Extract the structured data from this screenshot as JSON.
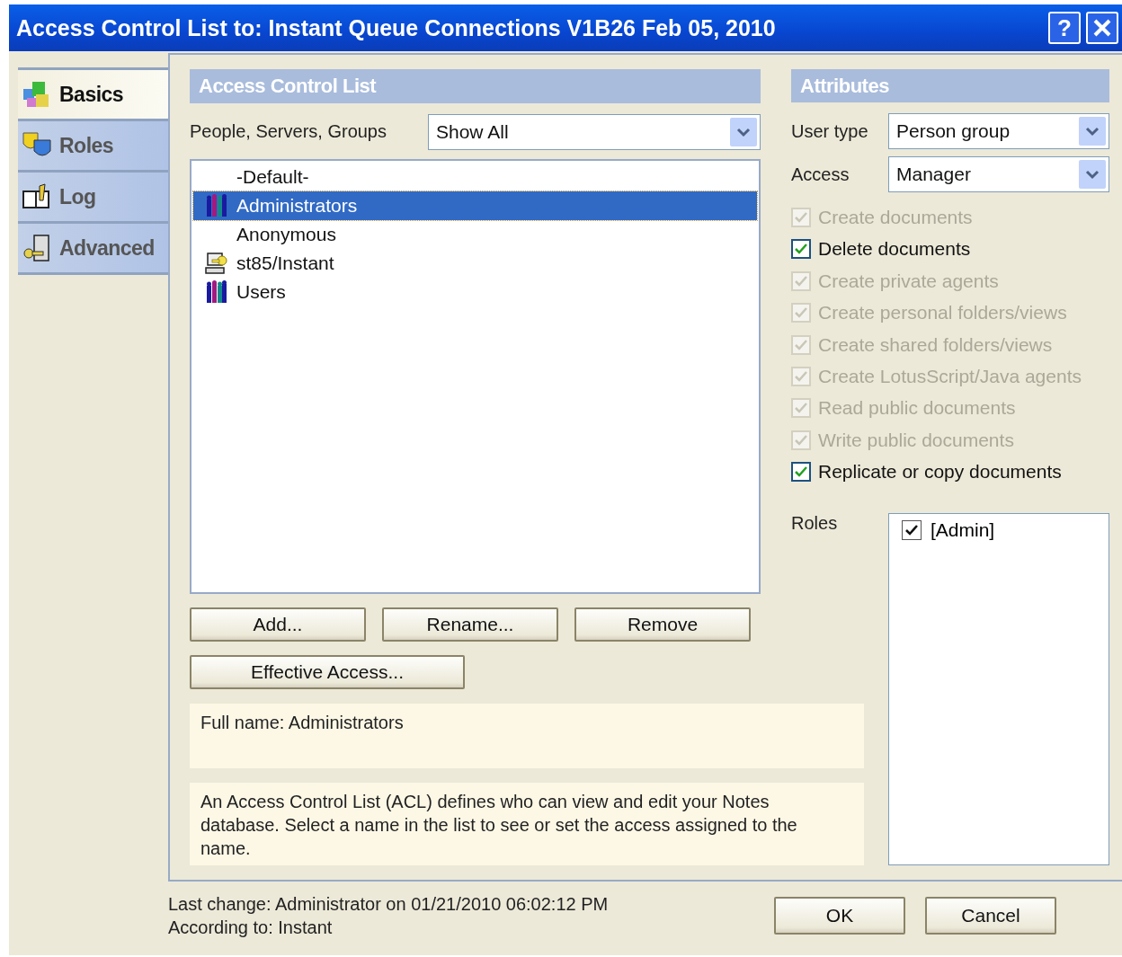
{
  "window": {
    "title": "Access Control List to: Instant Queue Connections V1B26 Feb 05, 2010",
    "help": "?"
  },
  "nav": [
    {
      "label": "Basics",
      "selected": true
    },
    {
      "label": "Roles",
      "selected": false
    },
    {
      "label": "Log",
      "selected": false
    },
    {
      "label": "Advanced",
      "selected": false
    }
  ],
  "acl": {
    "header": "Access Control List",
    "filter_label": "People, Servers, Groups",
    "filter_value": "Show All",
    "entries": [
      {
        "name": "-Default-",
        "kind": "plain",
        "selected": false
      },
      {
        "name": "Administrators",
        "kind": "group",
        "selected": true
      },
      {
        "name": "Anonymous",
        "kind": "plain",
        "selected": false
      },
      {
        "name": "st85/Instant",
        "kind": "server",
        "selected": false
      },
      {
        "name": "Users",
        "kind": "group",
        "selected": false
      }
    ],
    "buttons": [
      "Add...",
      "Rename...",
      "Remove"
    ],
    "effective_button": "Effective Access...",
    "full_name": "Full name: Administrators",
    "description": "An Access Control List (ACL) defines who can view and edit your Notes database.  Select a name in the list to see or set the access assigned to the name."
  },
  "attributes": {
    "header": "Attributes",
    "user_type_label": "User type",
    "user_type": "Person group",
    "access_label": "Access",
    "access": "Manager",
    "options": [
      {
        "label": "Create documents",
        "checked": true,
        "disabled": true
      },
      {
        "label": "Delete documents",
        "checked": true,
        "disabled": false
      },
      {
        "label": "Create private agents",
        "checked": true,
        "disabled": true
      },
      {
        "label": "Create personal folders/views",
        "checked": true,
        "disabled": true
      },
      {
        "label": "Create shared folders/views",
        "checked": true,
        "disabled": true
      },
      {
        "label": "Create LotusScript/Java agents",
        "checked": true,
        "disabled": true
      },
      {
        "label": "Read public documents",
        "checked": true,
        "disabled": true
      },
      {
        "label": "Write public documents",
        "checked": true,
        "disabled": true
      },
      {
        "label": "Replicate or copy documents",
        "checked": true,
        "disabled": false
      }
    ],
    "roles_label": "Roles",
    "roles": [
      {
        "name": "[Admin]",
        "checked": true
      }
    ]
  },
  "footer": {
    "last_change": "Last change: Administrator on 01/21/2010 06:02:12 PM",
    "according_to": "According to: Instant",
    "ok": "OK",
    "cancel": "Cancel"
  }
}
